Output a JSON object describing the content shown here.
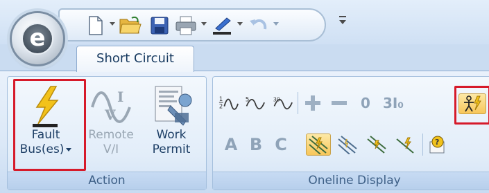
{
  "app": {
    "menu_button_letter": "e",
    "menu_button_icon": "etap-logo-icon"
  },
  "quick_access": {
    "items": [
      {
        "name": "new-document",
        "icon": "new-document-icon",
        "has_dropdown": true
      },
      {
        "name": "open",
        "icon": "open-folder-icon",
        "has_dropdown": false
      },
      {
        "name": "save",
        "icon": "save-icon",
        "has_dropdown": false
      },
      {
        "name": "print",
        "icon": "printer-icon",
        "has_dropdown": true
      },
      {
        "name": "format",
        "icon": "brush-underline-icon",
        "has_dropdown": true
      },
      {
        "name": "undo",
        "icon": "undo-icon",
        "has_dropdown": true,
        "disabled": true
      }
    ],
    "customize_icon": "customize-toolbar-icon"
  },
  "tabs": [
    {
      "label": "Short Circuit",
      "active": true
    }
  ],
  "groups": {
    "action": {
      "label": "Action",
      "buttons": {
        "fault": {
          "line1": "Fault",
          "line2": "Bus(es)",
          "icon": "lightning-bolt-icon",
          "has_dropdown": true,
          "highlighted": true
        },
        "remote": {
          "line1": "Remote",
          "line2": "V/I",
          "icon": "sine-wave-vi-icon",
          "disabled": true
        },
        "work": {
          "line1": "Work",
          "line2": "Permit",
          "icon": "work-permit-icon"
        }
      }
    },
    "oneline": {
      "label": "Oneline Display",
      "row1": [
        {
          "text": "½",
          "icon": "half-cycle-icon"
        },
        {
          "text": "5",
          "icon": "five-cycle-icon"
        },
        {
          "text": "30",
          "icon": "thirty-cycle-icon"
        },
        {
          "text": "+",
          "icon": "plus-icon",
          "disabled": true
        },
        {
          "text": "−",
          "icon": "minus-icon",
          "disabled": true
        },
        {
          "text": "0",
          "icon": "zero-icon",
          "disabled": true
        },
        {
          "text": "3I₀",
          "icon": "three-i-zero-icon",
          "disabled": true
        },
        {
          "text": "",
          "icon": "shock-person-icon",
          "active": true,
          "highlighted": true
        }
      ],
      "row2": [
        {
          "text": "A",
          "icon": "phase-a-icon",
          "disabled": true
        },
        {
          "text": "B",
          "icon": "phase-b-icon",
          "disabled": true
        },
        {
          "text": "C",
          "icon": "phase-c-icon",
          "disabled": true
        },
        {
          "text": "",
          "icon": "fault-type-3ph-icon",
          "active": true
        },
        {
          "text": "",
          "icon": "fault-type-llg-icon"
        },
        {
          "text": "",
          "icon": "fault-type-ll-icon"
        },
        {
          "text": "",
          "icon": "fault-type-lg-icon"
        },
        {
          "text": "",
          "icon": "display-options-icon"
        }
      ]
    }
  },
  "colors": {
    "highlight": "#d61a2a",
    "bolt": "#f2c21b",
    "active_button": "#f7c65a"
  }
}
